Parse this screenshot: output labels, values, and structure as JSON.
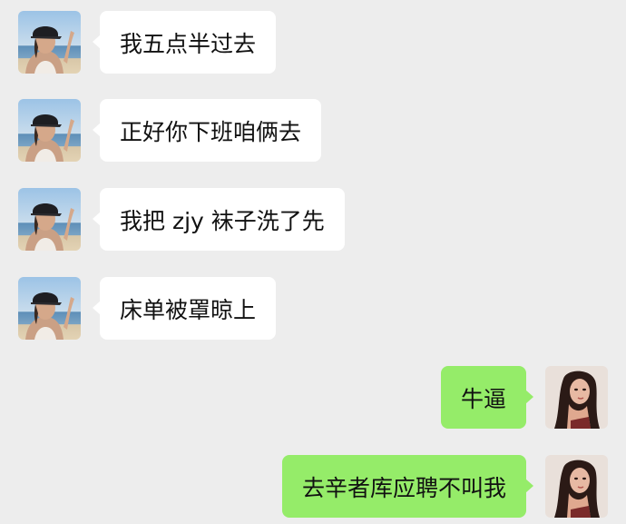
{
  "colors": {
    "background": "#ededed",
    "incoming_bubble": "#ffffff",
    "outgoing_bubble": "#95ec69",
    "text": "#111111"
  },
  "contact": {
    "avatar_icon": "beach-portrait-avatar-icon"
  },
  "me": {
    "avatar_icon": "portrait-avatar-icon"
  },
  "messages": [
    {
      "side": "incoming",
      "text": "我五点半过去"
    },
    {
      "side": "incoming",
      "text": "正好你下班咱俩去"
    },
    {
      "side": "incoming",
      "text": "我把 zjy 袜子洗了先"
    },
    {
      "side": "incoming",
      "text": "床单被罩晾上"
    },
    {
      "side": "outgoing",
      "text": "牛逼"
    },
    {
      "side": "outgoing",
      "text": "去辛者库应聘不叫我"
    }
  ]
}
